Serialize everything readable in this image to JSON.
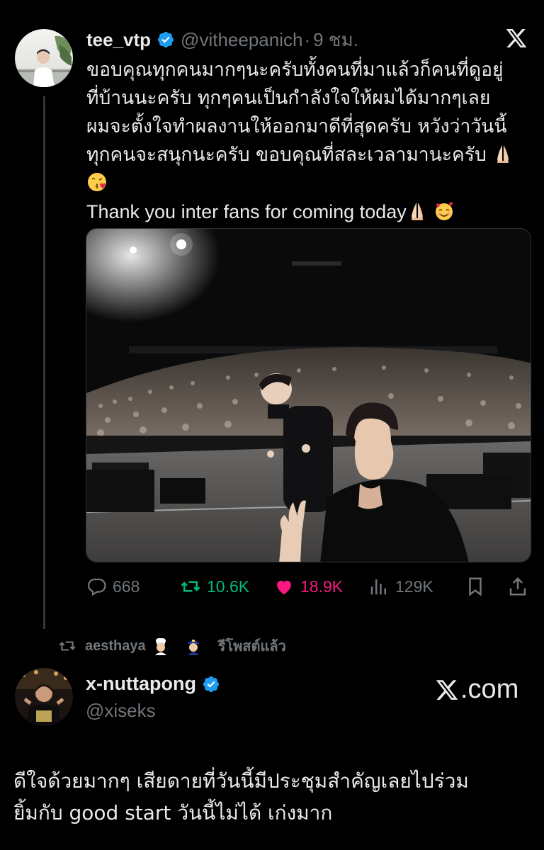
{
  "tweet": {
    "author_name": "tee_vtp",
    "author_handle": "@vitheepanich",
    "separator": "·",
    "time": "9 ชม.",
    "text_thai": "ขอบคุณทุกคนมากๆนะครับทั้งคนที่มาแล้วก็คนที่ดูอยู่\nที่บ้านนะครับ ทุกๆคนเป็นกำลังใจให้ผมได้มากๆเลย\nผมจะตั้งใจทำผลงานให้ออกมาดีที่สุดครับ หวังว่าวันนี้\nทุกคนจะสนุกนะครับ ขอบคุณที่สละเวลามานะครับ",
    "text_en": "Thank you inter fans for coming today",
    "emojis": [
      "folded-hands-emoji",
      "kissing-face-emoji",
      "folded-hands-emoji",
      "smiling-face-with-hearts-emoji"
    ],
    "stats": {
      "replies": "668",
      "reposts": "10.6K",
      "likes": "18.9K",
      "views": "129K"
    },
    "colors": {
      "repost_green": "#00ba7c",
      "like_pink": "#f91880",
      "verified_blue": "#1d9bf0",
      "muted_gray": "#71767b"
    }
  },
  "repost_bar": {
    "user": "aesthaya",
    "label": "รีโพสต์แล้ว",
    "emojis": [
      "man-cook-emoji",
      "police-officer-emoji"
    ]
  },
  "quote": {
    "author_name": "x-nuttapong",
    "author_handle": "@xiseks",
    "brand": ".com",
    "text": "ดีใจด้วยมากๆ เสียดายที่วันนี้มีประชุมสำคัญเลยไปร่วม\nยิ้มกับ good start วันนี้ไม่ได้ เก่งมาก"
  }
}
